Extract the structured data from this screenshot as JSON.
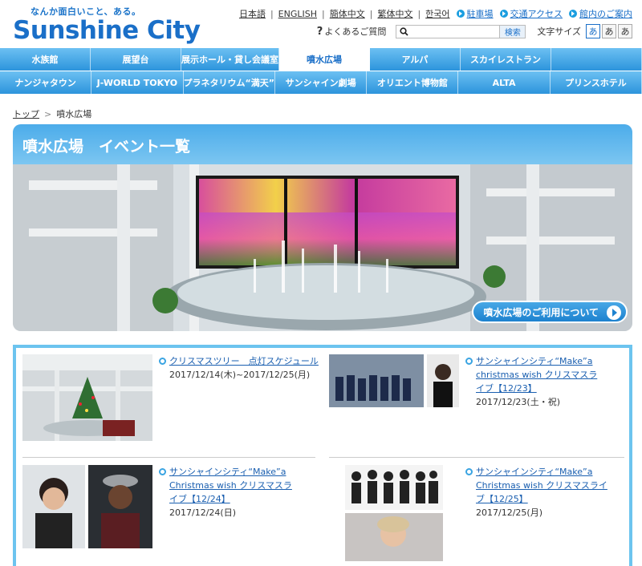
{
  "logo": {
    "tagline": "なんか面白いこと、ある。",
    "name": "Sunshine City"
  },
  "util": {
    "languages": [
      "日本語",
      "ENGLISH",
      "簡体中文",
      "繁体中文",
      "한국어"
    ],
    "links": [
      "駐車場",
      "交通アクセス",
      "館内のご案内"
    ],
    "faq": "よくあるご質問",
    "search_placeholder": "",
    "search_button": "検索",
    "font_size_label": "文字サイズ",
    "font_sizes": [
      "あ",
      "あ",
      "あ"
    ]
  },
  "nav": {
    "row1": [
      "水族館",
      "展望台",
      "展示ホール・貸し会議室",
      "噴水広場",
      "アルパ",
      "スカイレストラン",
      ""
    ],
    "row2": [
      "ナンジャタウン",
      "J-WORLD TOKYO",
      "プラネタリウム“満天”",
      "サンシャイン劇場",
      "オリエント博物館",
      "ALTA",
      "プリンスホテル"
    ],
    "active": "噴水広場"
  },
  "breadcrumb": {
    "home": "トップ",
    "current": "噴水広場"
  },
  "hero": {
    "title": "噴水広場　イベント一覧",
    "cta": "噴水広場のご利用について"
  },
  "events": [
    {
      "title": "クリスマスツリー　点灯スケジュール",
      "date": "2017/12/14(木)~2017/12/25(月)"
    },
    {
      "title": "サンシャインシティ“Make”a christmas wish クリスマスライブ【12/23】",
      "date": "2017/12/23(土・祝)"
    },
    {
      "title": "サンシャインシティ“Make”a Christmas wish クリスマスライブ【12/24】",
      "date": "2017/12/24(日)"
    },
    {
      "title": "サンシャインシティ“Make”a Christmas wish クリスマスライブ【12/25】",
      "date": "2017/12/25(月)"
    }
  ],
  "colors": {
    "brand": "#1a6fc8",
    "nav": "#2a93dc",
    "panel_border": "#6cc4ef"
  }
}
